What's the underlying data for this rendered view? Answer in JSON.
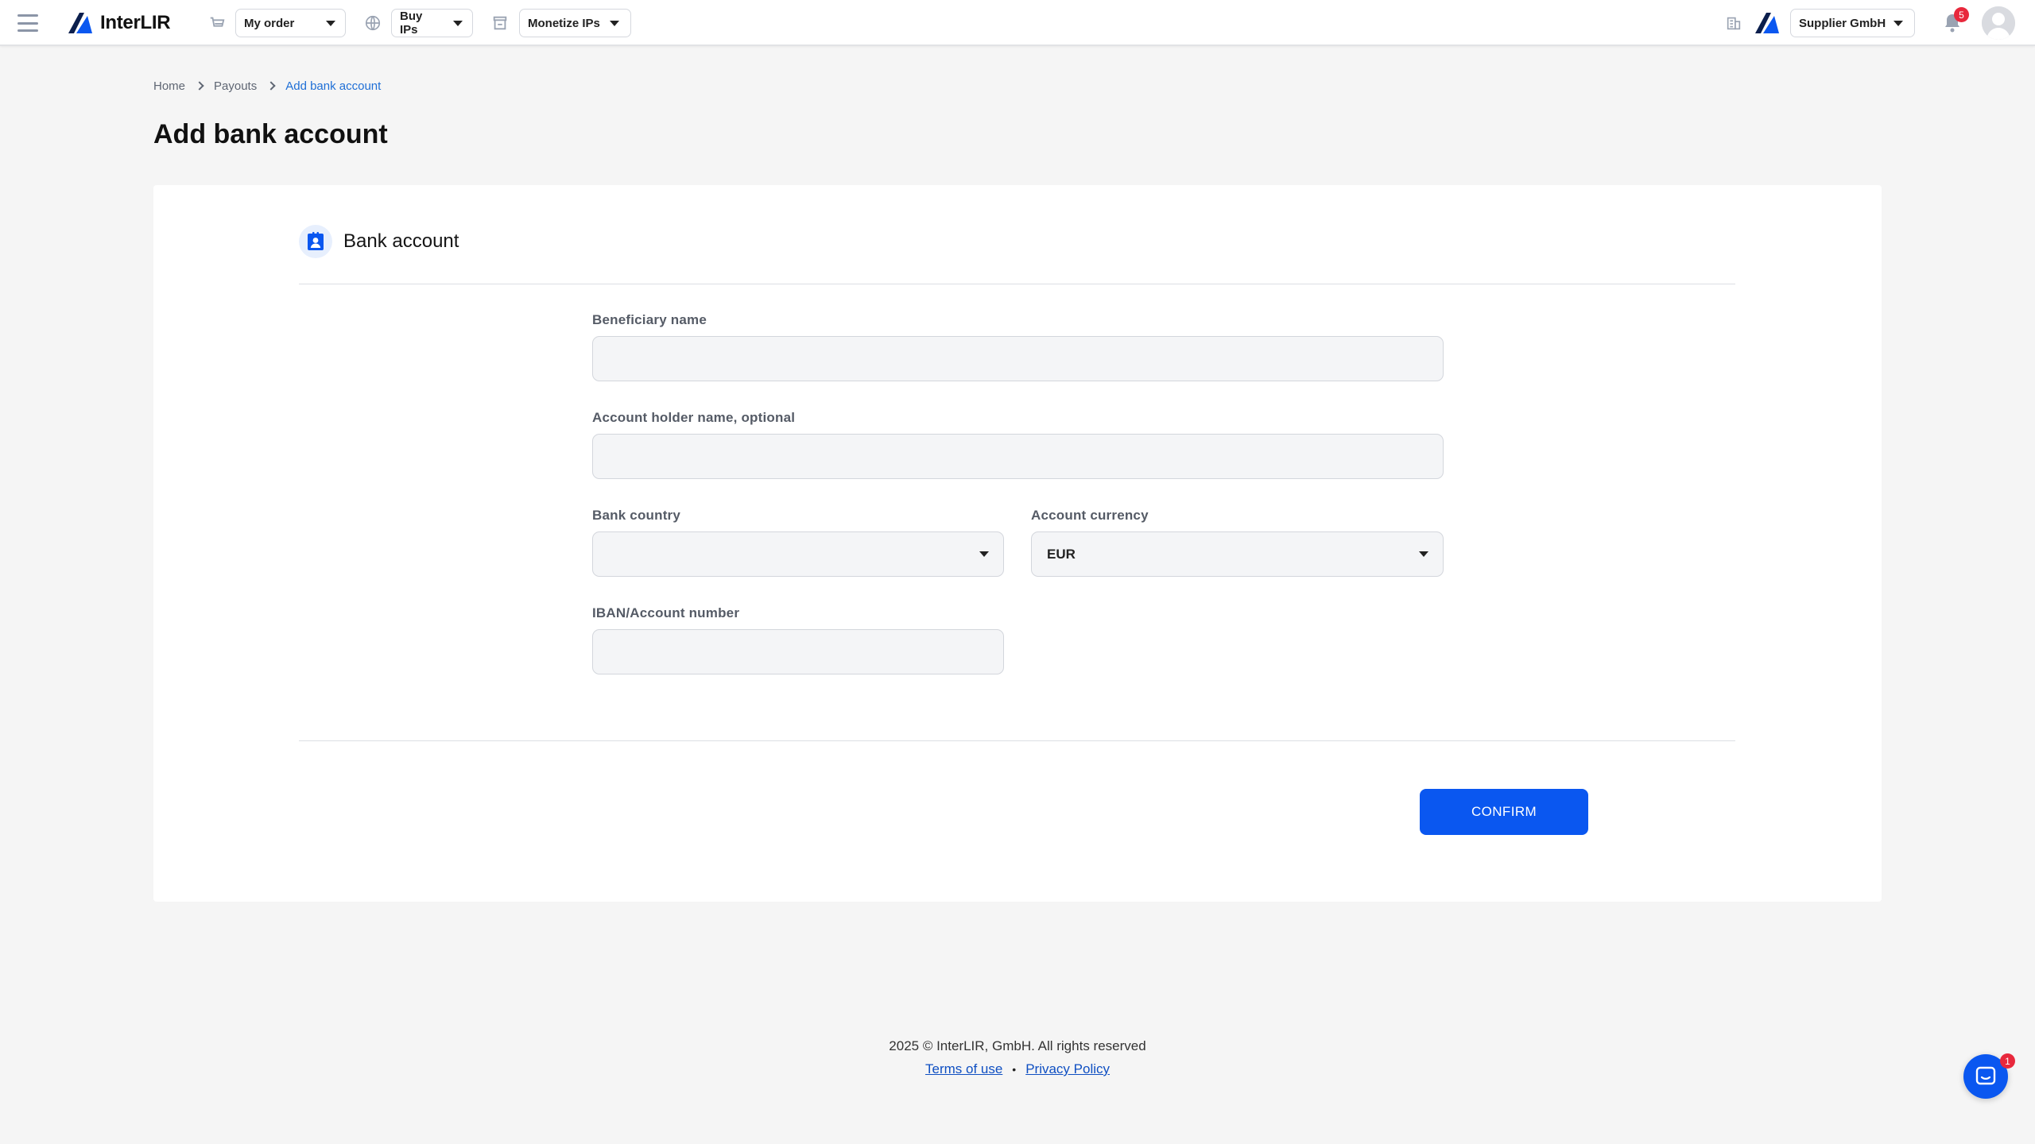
{
  "app": {
    "brand_name": "InterLIR",
    "brand_colors": {
      "primary": "#0a57f0",
      "logo_dark": "#0b1f4d",
      "badge": "#e8283c"
    }
  },
  "header": {
    "menu_icon": "hamburger-icon",
    "nav": [
      {
        "icon": "cart-icon",
        "label": "My order"
      },
      {
        "icon": "globe-network-icon",
        "label": "Buy IPs"
      },
      {
        "icon": "store-icon",
        "label": "Monetize IPs"
      }
    ],
    "company_icon": "building-icon",
    "company_label": "Supplier GmbH",
    "notification_count": "5",
    "avatar_icon": "user-avatar-icon"
  },
  "breadcrumb": {
    "items": [
      "Home",
      "Payouts",
      "Add bank account"
    ]
  },
  "page": {
    "title": "Add bank account"
  },
  "form": {
    "section_title": "Bank account",
    "section_icon": "contact-card-icon",
    "fields": {
      "beneficiary_name": {
        "label": "Beneficiary name",
        "value": ""
      },
      "account_holder": {
        "label": "Account holder name, optional",
        "value": ""
      },
      "bank_country": {
        "label": "Bank country",
        "value": ""
      },
      "account_currency": {
        "label": "Account currency",
        "value": "EUR"
      },
      "iban": {
        "label": "IBAN/Account number",
        "value": ""
      }
    },
    "confirm_label": "CONFIRM"
  },
  "footer": {
    "copyright": "2025 © InterLIR, GmbH. All rights reserved",
    "terms": "Terms of use",
    "separator": "•",
    "privacy": "Privacy Policy"
  },
  "chat": {
    "icon": "chat-icon",
    "badge_count": "1"
  }
}
